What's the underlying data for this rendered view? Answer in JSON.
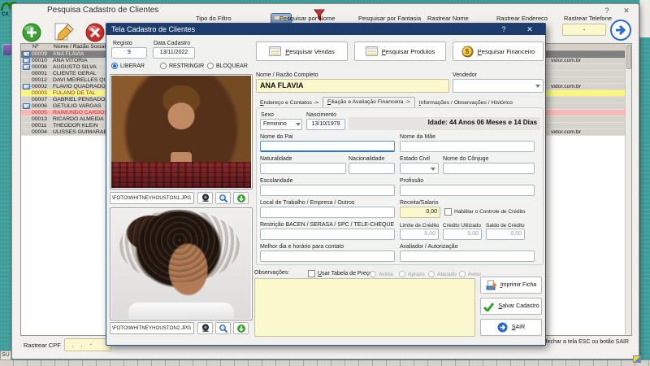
{
  "desktop": {
    "logo_label": "CA"
  },
  "colors": {
    "desktop_teal": "#3E9D9A",
    "titlebar_navy": "#1E3C6B",
    "field_yellow": "#FBF8CE",
    "row_selected": "#7F7F7F",
    "row_yellow": "#FAF77C",
    "row_pink": "#F9B8B6"
  },
  "main_window": {
    "title": "Pesquisa Cadastro de Clientes",
    "help_button": "?",
    "close_button": "✕",
    "filters": {
      "tipo": "Tipo do Filtro",
      "por_nome": "Pesquisar por Nome",
      "por_fantasia": "Pesquisar por Fantasia",
      "rastrear_nome": "Rastrear Nome",
      "rastrear_endereco": "Rastrear Endereco",
      "rastrear_telefone": "Rastrear Telefone"
    },
    "telefone_value": "-",
    "table": {
      "col_num": "Nº",
      "col_name": "Nome / Razão Social",
      "rows": [
        {
          "num": "00009",
          "name": "ANA FLAVIA",
          "photo": true,
          "highlight": "sel",
          "email": ""
        },
        {
          "num": "00010",
          "name": "ANA VITORIA",
          "photo": true,
          "highlight": "",
          "email": "vidor.com.br"
        },
        {
          "num": "00008",
          "name": "AUGUSTO SILVA",
          "photo": true,
          "highlight": "",
          "email": ""
        },
        {
          "num": "00001",
          "name": "CLIENTE GERAL",
          "photo": false,
          "highlight": "",
          "email": ""
        },
        {
          "num": "00012",
          "name": "DAVI MEIRELLES QUA",
          "photo": false,
          "highlight": "",
          "email": ""
        },
        {
          "num": "00002",
          "name": "FLAVIO QUADRADO",
          "photo": true,
          "highlight": "",
          "email": "vidor.com.br"
        },
        {
          "num": "00003",
          "name": "FULANO DE TAL",
          "photo": false,
          "highlight": "yellow",
          "email": ""
        },
        {
          "num": "00007",
          "name": "GABRIEL PENSADOR",
          "photo": false,
          "highlight": "",
          "email": ""
        },
        {
          "num": "00006",
          "name": "GETULIO VARGAS",
          "photo": true,
          "highlight": "",
          "email": ""
        },
        {
          "num": "00005",
          "name": "RAIMUNDO CARDOSO",
          "photo": false,
          "highlight": "pink",
          "email": ""
        },
        {
          "num": "00013",
          "name": "RICARDO ALMEIDA",
          "photo": false,
          "highlight": "",
          "email": ""
        },
        {
          "num": "00011",
          "name": "THEODOR KLEIN",
          "photo": false,
          "highlight": "",
          "email": ""
        },
        {
          "num": "00004",
          "name": "ULISSES GUIMARAES",
          "photo": false,
          "highlight": "",
          "email": "vidor.com.br"
        }
      ]
    },
    "rastrear_cpf_label": "Rastrear CPF",
    "cpf_value": " .    .    -",
    "footer_hint": "Para fechar a tela ESC ou botão SAIR",
    "taskbar_fragment": "SU"
  },
  "dialog": {
    "title": "Tela Cadastro de Clientes",
    "help_button": "?",
    "close_button": "✕",
    "registro": {
      "label": "Registo",
      "value": "9"
    },
    "data_cadastro": {
      "label": "Data Cadastro",
      "value": "13/11/2022"
    },
    "status_options": {
      "liberar": "LIBERAR",
      "restringir": "RESTRINGIR",
      "bloquear": "BLOQUEAR"
    },
    "photo1_path": "\\FOTO\\WHITNEYHOUSTON1.JPG",
    "photo2_path": "\\FOTO\\WHITNEYHOUSTON2.JPG",
    "top_buttons": {
      "vendas": "Pesquisar Vendas",
      "produtos": "Pesquisar Produtos",
      "financeiro": "Pesquisar Financeiro"
    },
    "nome": {
      "label": "Nome / Razão Completo",
      "value": "ANA FLAVIA"
    },
    "vendedor_label": "Vendedor",
    "tabs": {
      "t1": "Endereço e Contatos ->",
      "t2": "Filiação e Avaliação Financeira ->",
      "t3": "Informações / Observações / Histórico"
    },
    "form": {
      "sexo_label": "Sexo",
      "sexo_value": "Feminino",
      "nascimento_label": "Nascimento",
      "nascimento_value": "13/10/1979",
      "idade_text": "Idade: 44 Anos 06 Meses e 14 Dias",
      "pai_label": "Nome do Pai",
      "mae_label": "Nome da Mãe",
      "naturalidade_label": "Naturalidade",
      "nacionalidade_label": "Nacionalidade",
      "estado_civil_label": "Estado Civil",
      "conjuge_label": "Nome do Cônjuge",
      "escolaridade_label": "Escolaridade",
      "profissao_label": "Profissão",
      "trabalho_label": "Local de Trabalho / Empresa / Outros",
      "receita_label": "Receita/Salario",
      "receita_value": "0,00",
      "credito_check_label": "Habilitar o Controle de Crédito",
      "restricao_label": "Restrição BACEN / SERASA / SPC / TELE-CHEQUE",
      "limite_label": "Limite de Crédito",
      "limite_value": "0,00",
      "utilizado_label": "Crédito Utilizado",
      "utilizado_value": "0,00",
      "saldo_label": "Saldo de Crédito",
      "saldo_value": "0,00",
      "melhor_dia_label": "Melhor dia e horário para contato",
      "avaliador_label": "Avaliador / Autorização"
    },
    "observacoes": {
      "label": "Observações:",
      "tabela_preco_label": "Usar Tabela de Preço:",
      "radios": [
        "Avista",
        "Aprazo",
        "Atacado",
        "Aviso"
      ]
    },
    "action_buttons": {
      "imprimir": "Imprimir Ficha",
      "salvar": "Salvar Cadastro",
      "sair": "SAIR"
    }
  }
}
